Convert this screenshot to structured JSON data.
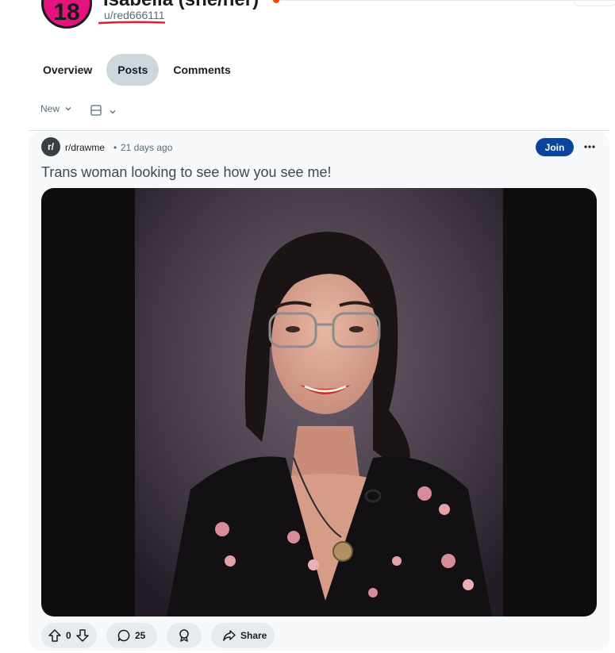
{
  "profile": {
    "avatar_text": "18",
    "display_name": "Isabella (she/her)",
    "username": "u/red666111"
  },
  "tabs": [
    {
      "label": "Overview",
      "active": false
    },
    {
      "label": "Posts",
      "active": true
    },
    {
      "label": "Comments",
      "active": false
    }
  ],
  "sort": {
    "label": "New"
  },
  "post": {
    "subreddit_icon_text": "r/",
    "subreddit": "r/drawme",
    "separator": "•",
    "time": "21 days ago",
    "join_label": "Join",
    "title": "Trans woman looking to see how you see me!",
    "votes": "0",
    "comments": "25",
    "share_label": "Share"
  },
  "colors": {
    "avatar_bg": "#e6127e",
    "join_bg": "#0a449b",
    "active_tab_bg": "#cbd9df",
    "underline_red": "#d9232e"
  },
  "icons": [
    "layout-icon",
    "chevron-down-icon",
    "more-icon",
    "upvote-icon",
    "downvote-icon",
    "comment-icon",
    "award-icon",
    "share-icon"
  ]
}
